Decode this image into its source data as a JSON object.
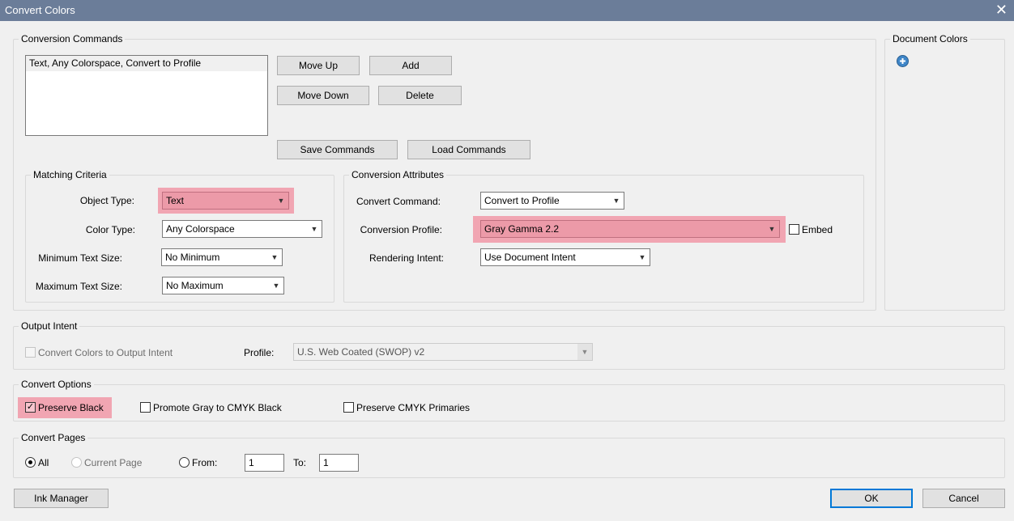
{
  "window": {
    "title": "Convert Colors",
    "close_glyph": "✕"
  },
  "conversion_commands": {
    "legend": "Conversion Commands",
    "items": [
      "Text, Any Colorspace, Convert to Profile"
    ],
    "buttons": {
      "move_up": "Move Up",
      "add": "Add",
      "move_down": "Move Down",
      "delete": "Delete",
      "save": "Save Commands",
      "load": "Load Commands"
    }
  },
  "matching_criteria": {
    "legend": "Matching Criteria",
    "object_type_label": "Object Type:",
    "object_type_value": "Text",
    "color_type_label": "Color Type:",
    "color_type_value": "Any Colorspace",
    "min_text_label": "Minimum Text Size:",
    "min_text_value": "No Minimum",
    "max_text_label": "Maximum Text Size:",
    "max_text_value": "No Maximum"
  },
  "conversion_attributes": {
    "legend": "Conversion Attributes",
    "command_label": "Convert Command:",
    "command_value": "Convert to Profile",
    "profile_label": "Conversion Profile:",
    "profile_value": "Gray Gamma 2.2",
    "embed_label": "Embed",
    "embed_checked": false,
    "intent_label": "Rendering Intent:",
    "intent_value": "Use Document Intent"
  },
  "document_colors": {
    "legend": "Document Colors",
    "icon": "plus-circle-icon"
  },
  "output_intent": {
    "legend": "Output Intent",
    "convert_label": "Convert Colors to Output Intent",
    "profile_label": "Profile:",
    "profile_value": "U.S. Web Coated (SWOP) v2"
  },
  "convert_options": {
    "legend": "Convert Options",
    "preserve_black": "Preserve Black",
    "preserve_black_checked": true,
    "promote_gray": "Promote Gray to CMYK Black",
    "preserve_primaries": "Preserve CMYK Primaries",
    "check_glyph": "✓"
  },
  "convert_pages": {
    "legend": "Convert Pages",
    "all": "All",
    "current": "Current Page",
    "from": "From:",
    "from_value": "1",
    "to": "To:",
    "to_value": "1"
  },
  "footer": {
    "ink_manager": "Ink Manager",
    "ok": "OK",
    "cancel": "Cancel"
  },
  "dropdown_arrow": "▼",
  "highlight_color": "#f1a5b2"
}
